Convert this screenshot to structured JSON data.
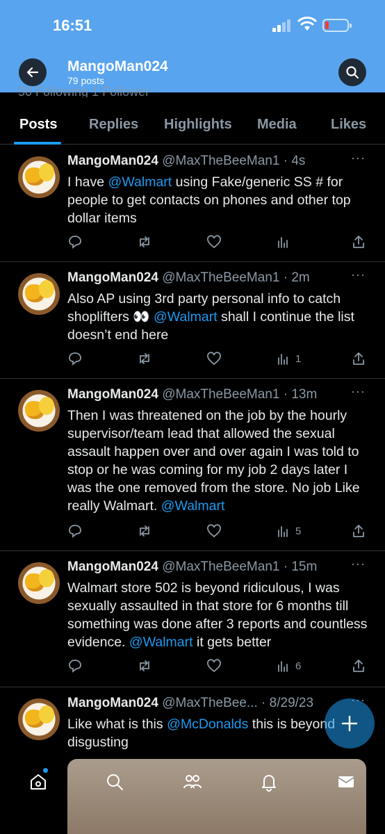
{
  "status_bar": {
    "time": "16:51"
  },
  "header": {
    "name": "MangoMan024",
    "posts_count": "79 posts",
    "follow_peek": "50 Following   1 Follower"
  },
  "tabs": [
    {
      "label": "Posts"
    },
    {
      "label": "Replies"
    },
    {
      "label": "Highlights"
    },
    {
      "label": "Media"
    },
    {
      "label": "Likes"
    }
  ],
  "posts": [
    {
      "name": "MangoMan024",
      "meta": "@MaxTheBeeMan1 · 4s",
      "text_parts": [
        "I have ",
        "@Walmart",
        " using Fake/generic SS # for people to get contacts on phones and other top dollar items"
      ],
      "views": ""
    },
    {
      "name": "MangoMan024",
      "meta": "@MaxTheBeeMan1 · 2m",
      "text_parts": [
        "Also AP using 3rd party personal info to catch shoplifters 👀 ",
        "@Walmart",
        " shall I continue the list doesn’t end here"
      ],
      "views": "1"
    },
    {
      "name": "MangoMan024",
      "meta": "@MaxTheBeeMan1 · 13m",
      "text_parts": [
        "Then I was threatened on the job by the hourly supervisor/team lead that allowed the sexual assault happen over and over again I was told to stop or he was coming for my job 2 days later I was the one removed from the store. No job Like really Walmart. ",
        "@Walmart",
        ""
      ],
      "views": "5"
    },
    {
      "name": "MangoMan024",
      "meta": "@MaxTheBeeMan1 · 15m",
      "text_parts": [
        "Walmart store 502 is beyond ridiculous, I was sexually assaulted in that store for 6 months till something was done after 3 reports and countless evidence. ",
        "@Walmart",
        "  it gets better"
      ],
      "views": "6"
    },
    {
      "name": "MangoMan024",
      "meta": "@MaxTheBee... · 8/29/23",
      "text_parts": [
        "Like what is this ",
        "@McDonalds",
        " this is beyond disgusting"
      ],
      "views": ""
    }
  ],
  "more_glyph": "···",
  "colors": {
    "header_bg": "#58a4ee",
    "accent": "#1d9bf0",
    "muted": "#8b98a5"
  },
  "icons": [
    "back-arrow-icon",
    "search-icon",
    "reply-icon",
    "retweet-icon",
    "like-icon",
    "views-icon",
    "share-icon",
    "compose-icon",
    "home-icon",
    "explore-icon",
    "communities-icon",
    "notifications-icon",
    "messages-icon"
  ]
}
